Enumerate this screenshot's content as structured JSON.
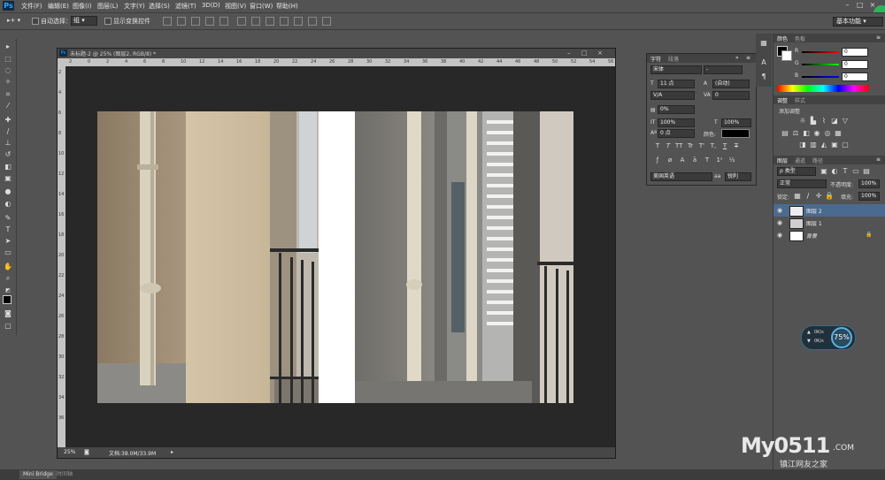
{
  "app": {
    "logo": "Ps"
  },
  "menu": [
    "文件(F)",
    "编辑(E)",
    "图像(I)",
    "图层(L)",
    "文字(Y)",
    "选择(S)",
    "滤镜(T)",
    "3D(D)",
    "视图(V)",
    "窗口(W)",
    "帮助(H)"
  ],
  "window_controls": [
    "–",
    "□",
    "×"
  ],
  "options_bar": {
    "auto_select_label": "自动选择：",
    "auto_select_value": "组",
    "show_transform_label": "显示变换控件",
    "workspace": "基本功能"
  },
  "document": {
    "tab_title": "未标题-2 @ 25% (图层2, RGB/8) *",
    "zoom": "25%",
    "doc_info": "文档:38.0M/33.9M",
    "ruler_h": [
      "2",
      "0",
      "2",
      "4",
      "6",
      "8",
      "10",
      "12",
      "14",
      "16",
      "18",
      "20",
      "22",
      "24",
      "26",
      "28",
      "30",
      "32",
      "34",
      "36",
      "38",
      "40",
      "42",
      "44",
      "46",
      "48",
      "50",
      "52",
      "54",
      "56"
    ],
    "ruler_v": [
      "2",
      "4",
      "6",
      "8",
      "10",
      "12",
      "14",
      "16",
      "18",
      "20",
      "22",
      "24",
      "26",
      "28",
      "30",
      "32",
      "34",
      "36"
    ]
  },
  "bottom_tabs": [
    "Mini Bridge",
    "时间轴"
  ],
  "character_panel": {
    "tabs": [
      "字符",
      "段落"
    ],
    "font_family": "宋体",
    "font_style": "-",
    "font_size": "11 点",
    "leading": "(自动)",
    "kerning": "V/A",
    "tracking": "0",
    "scale_value": "0%",
    "vertical_scale": "100%",
    "horizontal_scale": "100%",
    "baseline": "0 点",
    "color_label": "颜色:",
    "style_buttons": [
      "T",
      "T",
      "TT",
      "Tr",
      "T'",
      "T,",
      "T",
      "T"
    ],
    "language": "美国英语",
    "antialias": "锐利"
  },
  "color_panel": {
    "tabs": [
      "颜色",
      "色板"
    ],
    "channels": [
      {
        "label": "R",
        "value": "0"
      },
      {
        "label": "G",
        "value": "0"
      },
      {
        "label": "B",
        "value": "0"
      }
    ]
  },
  "adjust_panel": {
    "tabs": [
      "调整",
      "样式"
    ],
    "title": "添加调整"
  },
  "layers_panel": {
    "tabs": [
      "图层",
      "通道",
      "路径"
    ],
    "filter": "类型",
    "blend_mode": "正常",
    "opacity_label": "不透明度:",
    "opacity": "100%",
    "lock_label": "锁定:",
    "fill_label": "填充:",
    "fill": "100%",
    "layers": [
      {
        "name": "图层 2",
        "selected": true
      },
      {
        "name": "图层 1",
        "selected": false
      },
      {
        "name": "背景",
        "selected": false
      }
    ]
  },
  "speed_widget": {
    "up": "0K/s",
    "down": "0K/s",
    "percent": "75%"
  },
  "watermark": {
    "brand": "My0511",
    "suffix": ".COM",
    "tagline": "镇江网友之家"
  },
  "colors": {
    "bg": "#535353",
    "canvas": "#282828",
    "accent": "#31a8ff"
  }
}
